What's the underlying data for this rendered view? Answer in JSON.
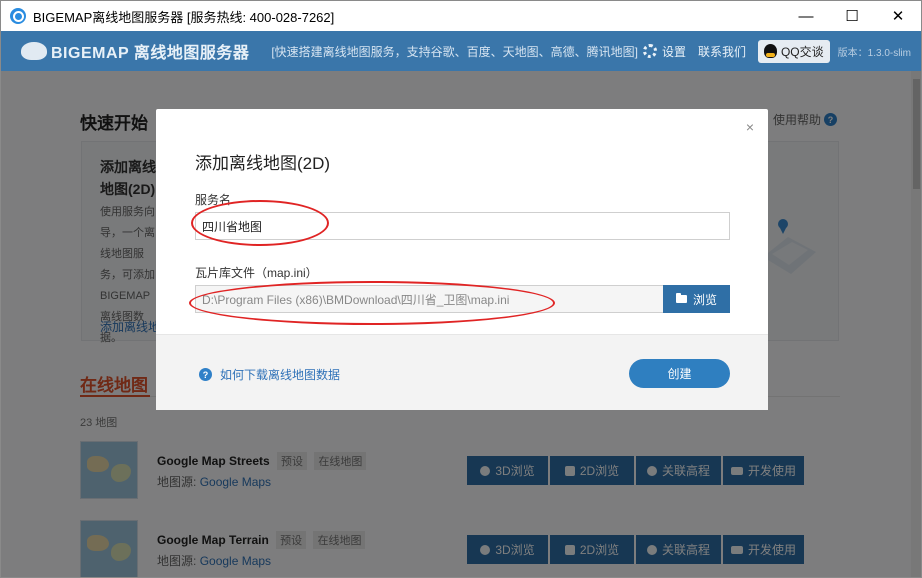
{
  "window": {
    "title": "BIGEMAP离线地图服务器 [服务热线: 400-028-7262]",
    "minimize": "—",
    "maximize": "☐",
    "close": "✕"
  },
  "header": {
    "logo_text": "BIGEMAP 离线地图服务器",
    "slogan": "[快速搭建离线地图服务，支持谷歌、百度、天地图、高德、腾讯地图]",
    "settings": "设置",
    "contact": "联系我们",
    "qq": "QQ交谈",
    "version": "版本：1.3.0-slim",
    "brand_color": "#3a76aa"
  },
  "quick_start": {
    "title": "快速开始",
    "help": "使用帮助",
    "card_title": "添加离线地图(2D)",
    "card_desc": "使用服务向导，一个离线地图服务，可添加BIGEMAP离线图数据。",
    "card_link": "添加离线地图"
  },
  "online": {
    "title": "在线地图",
    "count": "23 地图",
    "maps": [
      {
        "name": "Google Map Streets",
        "tag1": "预设",
        "tag2": "在线地图",
        "source_label": "地图源:",
        "source": "Google Maps"
      },
      {
        "name": "Google Map Terrain",
        "tag1": "预设",
        "tag2": "在线地图",
        "source_label": "地图源:",
        "source": "Google Maps"
      }
    ],
    "actions": {
      "view3d": "3D浏览",
      "view2d": "2D浏览",
      "elevation": "关联高程",
      "dev": "开发使用"
    }
  },
  "modal": {
    "title": "添加离线地图(2D)",
    "close": "×",
    "service_label": "服务名",
    "service_value": "四川省地图",
    "tile_label": "瓦片库文件（map.ini）",
    "tile_value": "D:\\Program Files (x86)\\BMDownload\\四川省_卫图\\map.ini",
    "browse": "浏览",
    "help_link": "如何下载离线地图数据",
    "create": "创建"
  }
}
